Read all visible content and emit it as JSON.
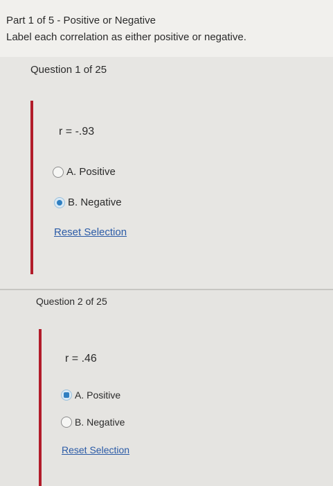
{
  "header": {
    "part_title": "Part 1 of 5 - Positive or Negative",
    "instructions": "Label each correlation as either positive or negative."
  },
  "questions": [
    {
      "label": "Question 1 of 25",
      "stem": "r = -.93",
      "options": [
        {
          "label": "A. Positive",
          "selected": false
        },
        {
          "label": "B. Negative",
          "selected": true
        }
      ],
      "reset_label": "Reset Selection"
    },
    {
      "label": "Question 2 of 25",
      "stem": "r = .46",
      "options": [
        {
          "label": "A. Positive",
          "selected": true
        },
        {
          "label": "B. Negative",
          "selected": false
        }
      ],
      "reset_label": "Reset Selection"
    }
  ],
  "colors": {
    "accent_bar": "#b21c2a",
    "link": "#2a5aa6",
    "radio_selected": "#2f7fc1"
  },
  "icons": {
    "radio_unchecked": "radio-unchecked-icon",
    "radio_checked": "radio-checked-icon"
  }
}
